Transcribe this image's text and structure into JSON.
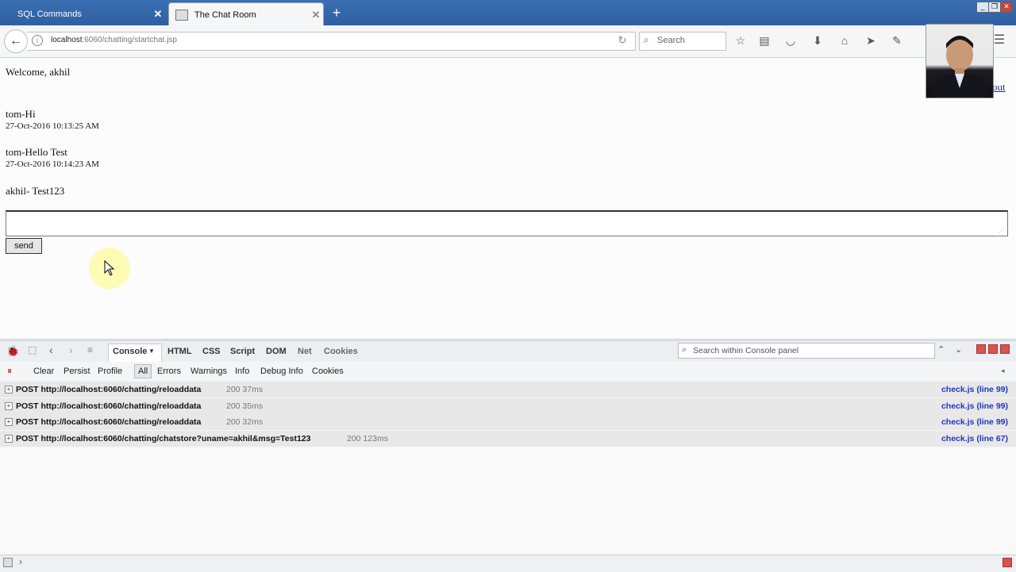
{
  "browser": {
    "tabs": [
      {
        "label": "SQL Commands",
        "active": false
      },
      {
        "label": "The Chat Room",
        "active": true
      }
    ],
    "url_host": "localhost",
    "url_path": ":6060/chatting/startchat.jsp",
    "search_placeholder": "Search"
  },
  "page": {
    "welcome": "Welcome, akhil",
    "messages": [
      {
        "text": "tom-Hi",
        "time": "27-Oct-2016 10:13:25 AM"
      },
      {
        "text": "tom-Hello Test",
        "time": "27-Oct-2016 10:14:23 AM"
      },
      {
        "text": "akhil- Test123",
        "time": ""
      }
    ],
    "send_label": "send",
    "logout_label": "out"
  },
  "firebug": {
    "panels": [
      "Console",
      "HTML",
      "CSS",
      "Script",
      "DOM",
      "Net",
      "Cookies"
    ],
    "search_placeholder": "Search within Console panel",
    "console_filters": [
      "Clear",
      "Persist",
      "Profile",
      "All",
      "Errors",
      "Warnings",
      "Info",
      "Debug Info",
      "Cookies"
    ],
    "log": [
      {
        "request": "POST http://localhost:6060/chatting/reloaddata",
        "status": "200 37ms",
        "source": "check.js (line 99)"
      },
      {
        "request": "POST http://localhost:6060/chatting/reloaddata",
        "status": "200 35ms",
        "source": "check.js (line 99)"
      },
      {
        "request": "POST http://localhost:6060/chatting/reloaddata",
        "status": "200 32ms",
        "source": "check.js (line 99)"
      },
      {
        "request": "POST http://localhost:6060/chatting/chatstore?uname=akhil&msg=Test123",
        "status": "200 123ms",
        "source": "check.js (line 67)"
      }
    ]
  }
}
